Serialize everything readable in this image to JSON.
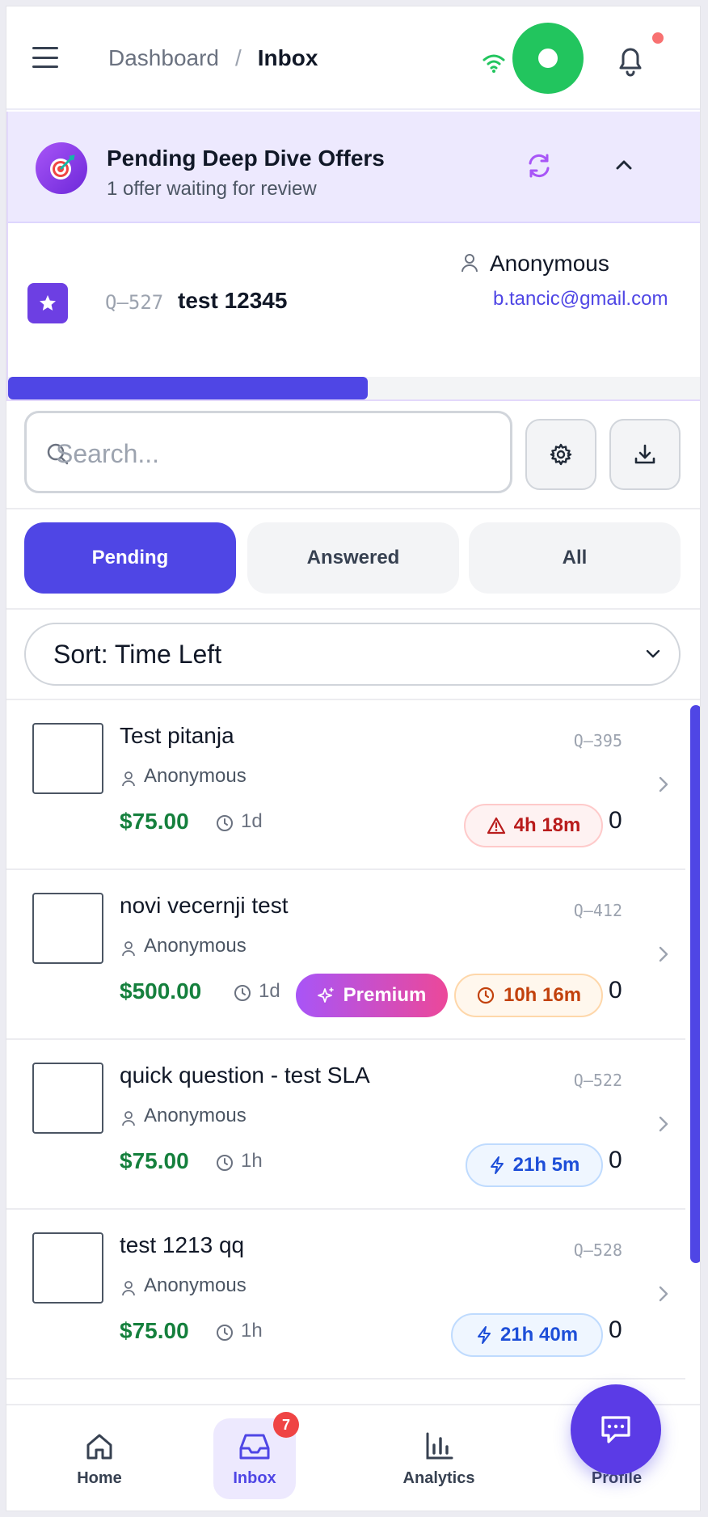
{
  "header": {
    "breadcrumb_parent": "Dashboard",
    "breadcrumb_separator": "/",
    "breadcrumb_current": "Inbox",
    "notification_dot_color": "#f87171",
    "recording_color": "#22c55e"
  },
  "offers": {
    "title": "Pending Deep Dive Offers",
    "subtitle": "1 offer waiting for review",
    "icon": "target-icon",
    "item": {
      "qid": "Q–527",
      "title": "test 12345",
      "author": "Anonymous",
      "email": "b.tancic@gmail.com"
    },
    "progress": 0.52
  },
  "search": {
    "placeholder": "Search..."
  },
  "tabs": [
    {
      "label": "Pending",
      "active": true
    },
    {
      "label": "Answered",
      "active": false
    },
    {
      "label": "All",
      "active": false
    }
  ],
  "sort": {
    "label": "Sort: Time Left"
  },
  "questions": [
    {
      "title": "Test pitanja",
      "qid": "Q–395",
      "author": "Anonymous",
      "price": "$75.00",
      "age": "1d",
      "premium": false,
      "sla": "4h 18m",
      "sla_status": "overdue",
      "count": "0"
    },
    {
      "title": "novi vecernji test",
      "qid": "Q–412",
      "author": "Anonymous",
      "price": "$500.00",
      "age": "1d",
      "premium": true,
      "premium_label": "Premium",
      "sla": "10h 16m",
      "sla_status": "warning",
      "count": "0"
    },
    {
      "title": "quick question - test SLA",
      "qid": "Q–522",
      "author": "Anonymous",
      "price": "$75.00",
      "age": "1h",
      "premium": false,
      "sla": "21h 5m",
      "sla_status": "ok",
      "count": "0"
    },
    {
      "title": "test 1213 qq",
      "qid": "Q–528",
      "author": "Anonymous",
      "price": "$75.00",
      "age": "1h",
      "premium": false,
      "sla": "21h 40m",
      "sla_status": "ok",
      "count": "0"
    }
  ],
  "bottom_nav": {
    "items": [
      {
        "label": "Home",
        "icon": "home-icon",
        "active": false
      },
      {
        "label": "Inbox",
        "icon": "inbox-icon",
        "active": true,
        "badge": "7"
      },
      {
        "label": "Analytics",
        "icon": "bar-chart-icon",
        "active": false
      },
      {
        "label": "Profile",
        "icon": "user-icon",
        "active": false
      }
    ]
  },
  "colors": {
    "accent": "#4f46e5",
    "price": "#15803d",
    "premium_from": "#a855f7",
    "premium_to": "#ec4899"
  }
}
